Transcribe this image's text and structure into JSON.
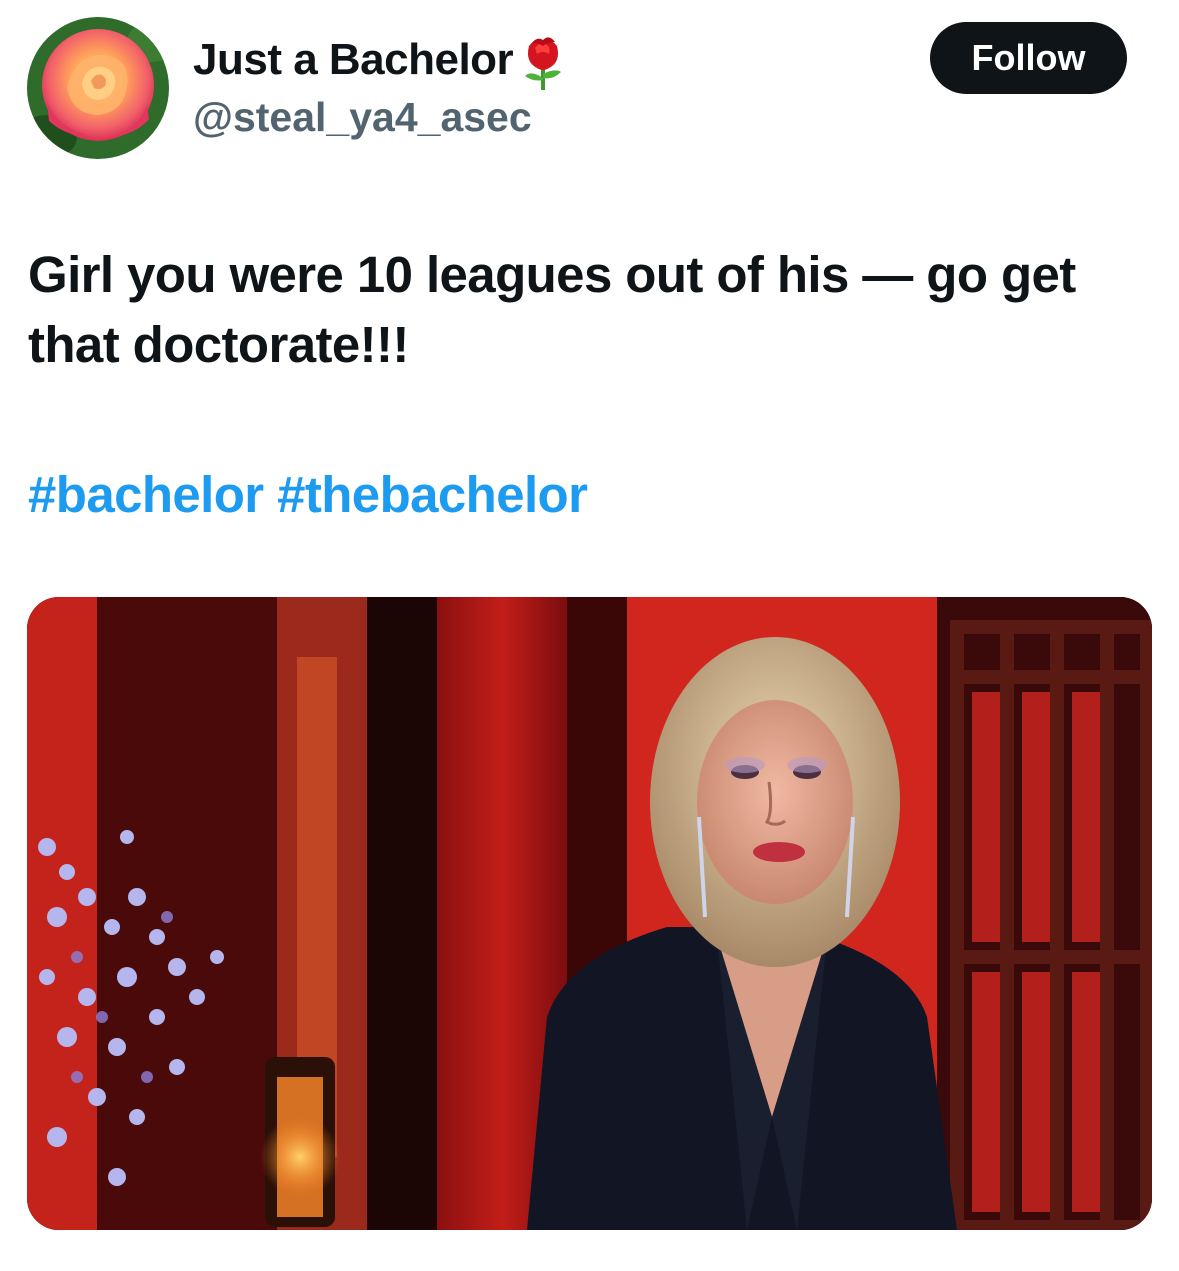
{
  "author": {
    "display_name": "Just a Bachelor",
    "name_emoji": "rose-icon",
    "handle": "@steal_ya4_asec",
    "avatar": "rose-avatar"
  },
  "follow_button": {
    "label": "Follow"
  },
  "tweet": {
    "text": "Girl you were 10 leagues out of his — go get that doctorate!!!",
    "hashtags": [
      "#bachelor",
      "#thebachelor"
    ]
  },
  "media": {
    "kind": "photo-of-tv-screen"
  },
  "colors": {
    "text_primary": "#0f1419",
    "text_secondary": "#536471",
    "link": "#1d9bf0",
    "follow_bg": "#0f1419"
  }
}
